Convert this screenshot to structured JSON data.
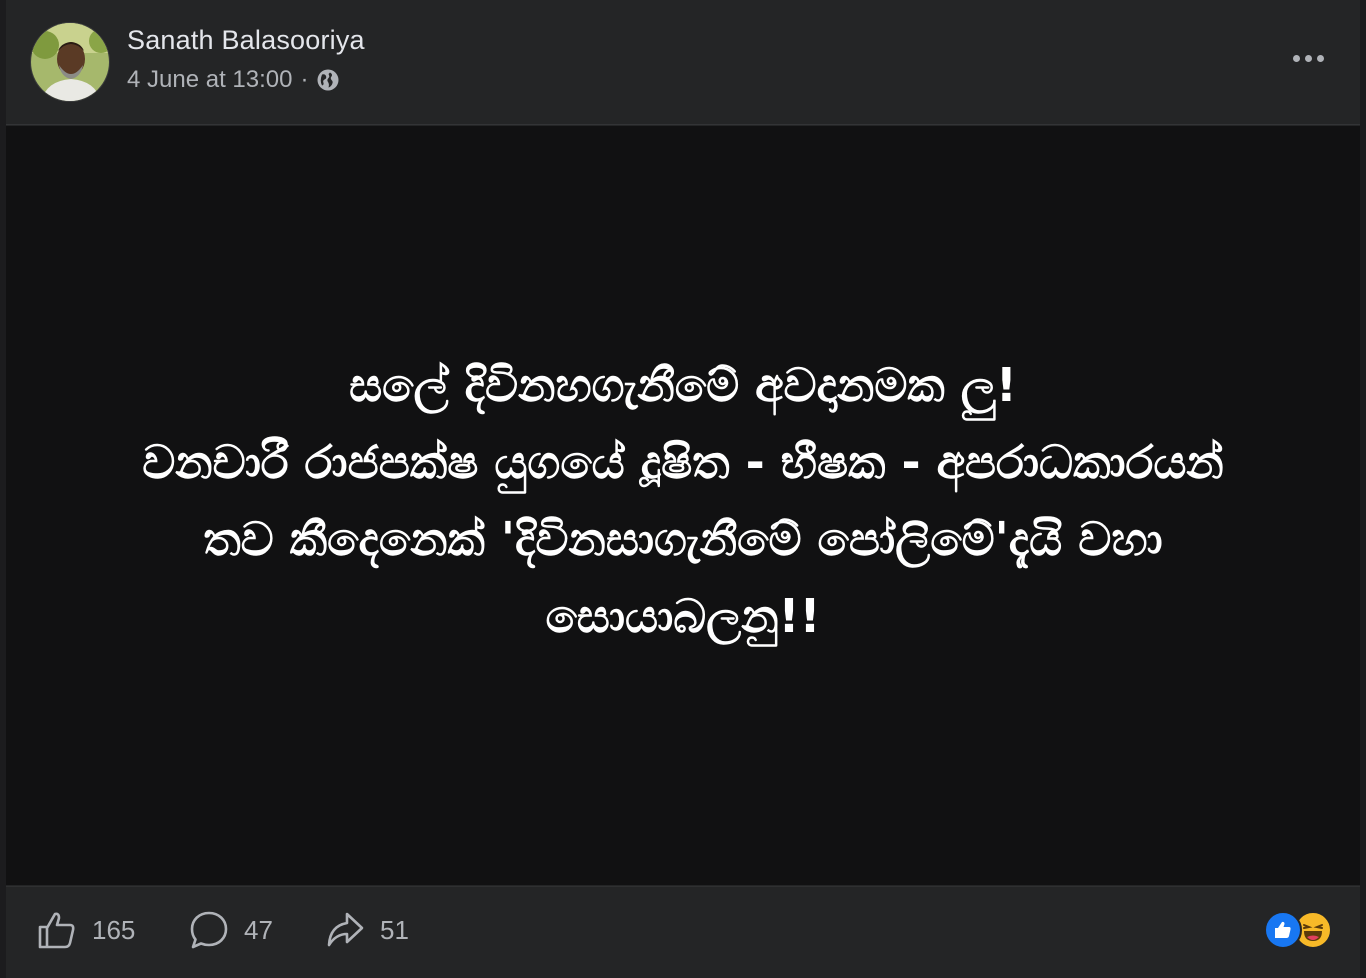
{
  "post": {
    "author": "Sanath Balasooriya",
    "timestamp": "4 June at 13:00",
    "separator": "·",
    "privacy_icon": "globe-icon",
    "more_icon": "more-dots-icon",
    "text_lines": [
      "සලේ දිවිනහගැනීමේ අවදානමක ලු!",
      "වනචාරී රාජපක්ෂ යුගයේ දූෂිත - භීෂක - අපරාධකාරයන්",
      "තව කීදෙනෙක් 'දිවිනසාගැනීමේ පෝලිමේ'දැයි වහා",
      "සොයාබලනු!!"
    ]
  },
  "actions": {
    "like": {
      "icon": "thumbs-up-icon",
      "count": "165"
    },
    "comment": {
      "icon": "comment-bubble-icon",
      "count": "47"
    },
    "share": {
      "icon": "share-arrow-icon",
      "count": "51"
    }
  },
  "reactions": [
    {
      "icon": "like-reaction-icon",
      "color": "#1877f2"
    },
    {
      "icon": "haha-reaction-icon",
      "color": "#f7b928"
    }
  ],
  "colors": {
    "background": "#242526",
    "content_background": "#111112",
    "text_primary": "#e4e6eb",
    "text_secondary": "#b0b3b8",
    "post_text": "#ffffff"
  }
}
